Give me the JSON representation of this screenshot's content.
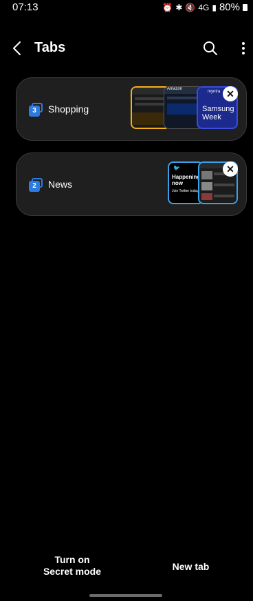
{
  "status": {
    "time": "07:13",
    "signal_label": "4G",
    "battery": "80%"
  },
  "header": {
    "title": "Tabs"
  },
  "groups": [
    {
      "name": "Shopping",
      "count": "3",
      "previews": [
        "Amazon",
        "myntra",
        "Samsung Week"
      ]
    },
    {
      "name": "News",
      "count": "2",
      "previews": [
        "Happening now",
        "Join Twitter today"
      ]
    }
  ],
  "footer": {
    "secret_mode_label": "Turn on\nSecret mode",
    "new_tab_label": "New tab"
  },
  "colors": {
    "accent_blue": "#2d7be0",
    "card_bg": "#1f1f1f",
    "thumb_yellow": "#f3b21b",
    "thumb_blue": "#3aa0e8"
  }
}
